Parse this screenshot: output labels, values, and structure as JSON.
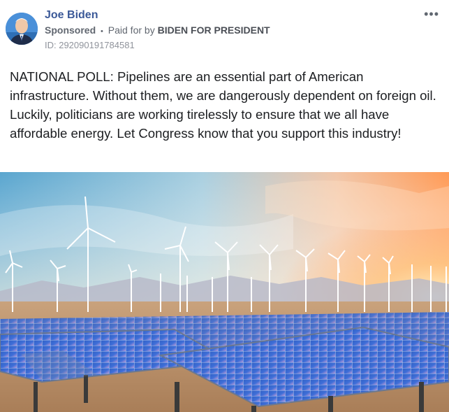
{
  "post": {
    "author": "Joe Biden",
    "sponsored_label": "Sponsored",
    "separator": "•",
    "paid_for_prefix": "Paid for by",
    "payer": "BIDEN FOR PRESIDENT",
    "ad_id": "ID: 292090191784581",
    "more_icon": "ellipsis-icon",
    "text": "NATIONAL POLL: Pipelines are an essential part of American infrastructure. Without them, we are dangerously dependent on foreign oil. Luckily, politicians are working tirelessly to ensure that we all have affordable energy. Let Congress know that you support this industry!"
  },
  "colors": {
    "author_link": "#3b5998",
    "meta_gray": "#616770",
    "body_text": "#1c1e21"
  }
}
